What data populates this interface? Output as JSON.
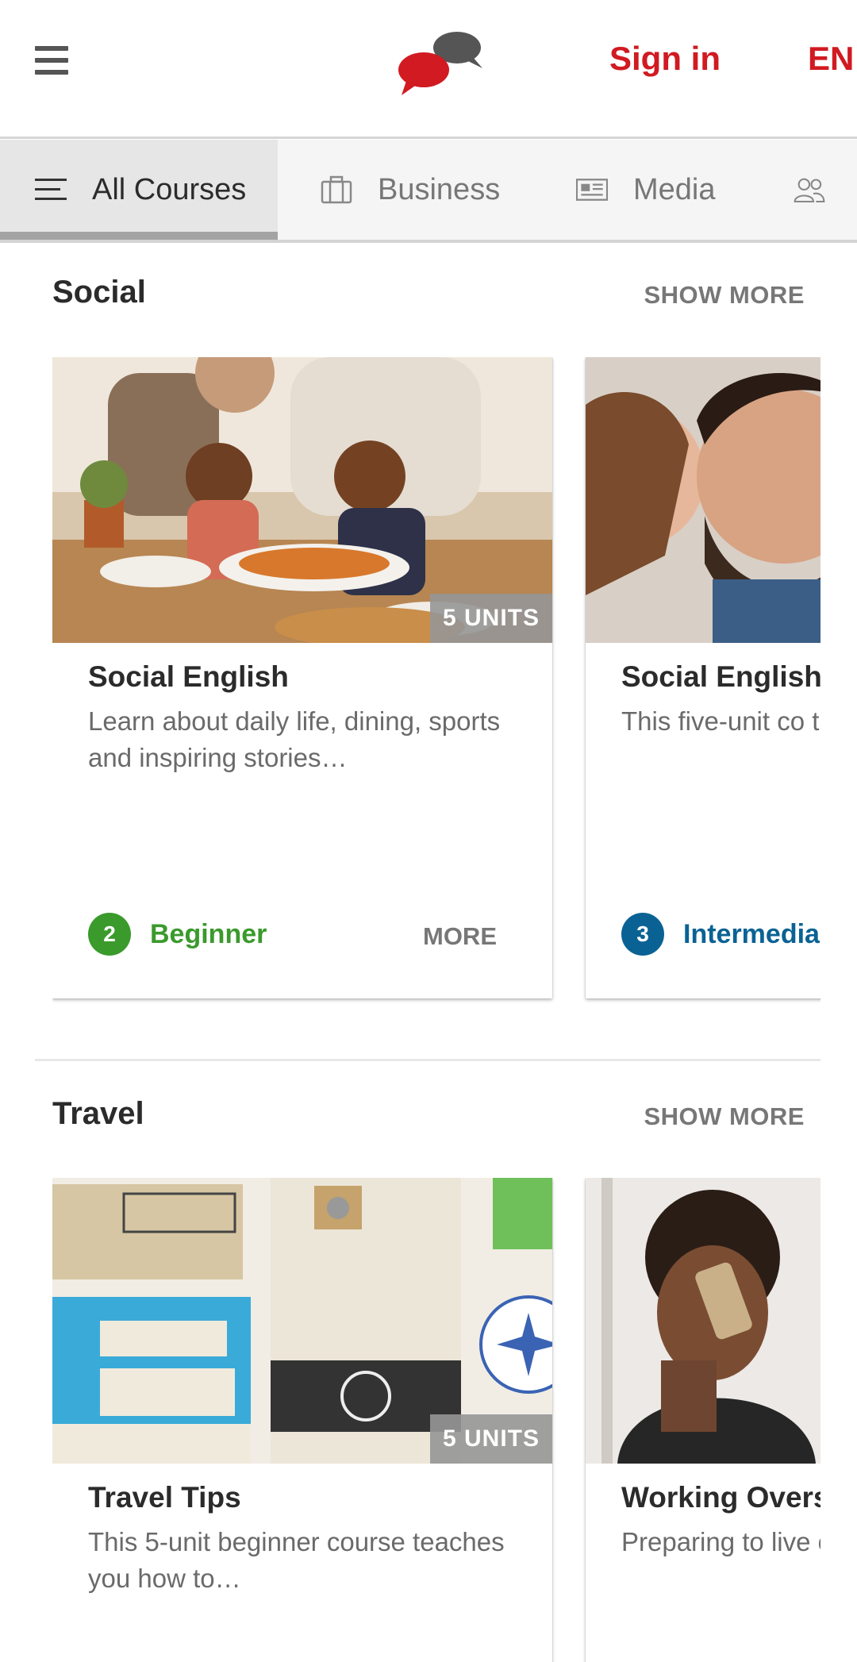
{
  "header": {
    "menu_icon": "hamburger-menu-icon",
    "logo_icon": "speech-bubbles-logo",
    "sign_in": "Sign in",
    "language": "EN",
    "brand_color": "#d11a21"
  },
  "tabs": [
    {
      "label": "All Courses",
      "icon": "list-icon",
      "active": true
    },
    {
      "label": "Business",
      "icon": "briefcase-icon",
      "active": false
    },
    {
      "label": "Media",
      "icon": "newspaper-icon",
      "active": false
    },
    {
      "label": "",
      "icon": "people-icon",
      "active": false
    }
  ],
  "sections": [
    {
      "title": "Social",
      "show_more": "SHOW MORE",
      "cards": [
        {
          "units": "5 UNITS",
          "title": "Social English",
          "description": "Learn about daily life, dining, sports and inspiring stories…",
          "level_number": "2",
          "level_name": "Beginner",
          "level_color": "#3a9a2c",
          "more": "MORE"
        },
        {
          "title": "Social English",
          "description": "This five-unit co the best social v",
          "level_number": "3",
          "level_name": "Intermedia",
          "level_color": "#0a6294"
        }
      ]
    },
    {
      "title": "Travel",
      "show_more": "SHOW MORE",
      "cards": [
        {
          "units": "5 UNITS",
          "title": "Travel Tips",
          "description": "This 5-unit beginner course teaches you how to…"
        },
        {
          "title": "Working Overs",
          "description": "Preparing to live other countries"
        }
      ]
    }
  ]
}
